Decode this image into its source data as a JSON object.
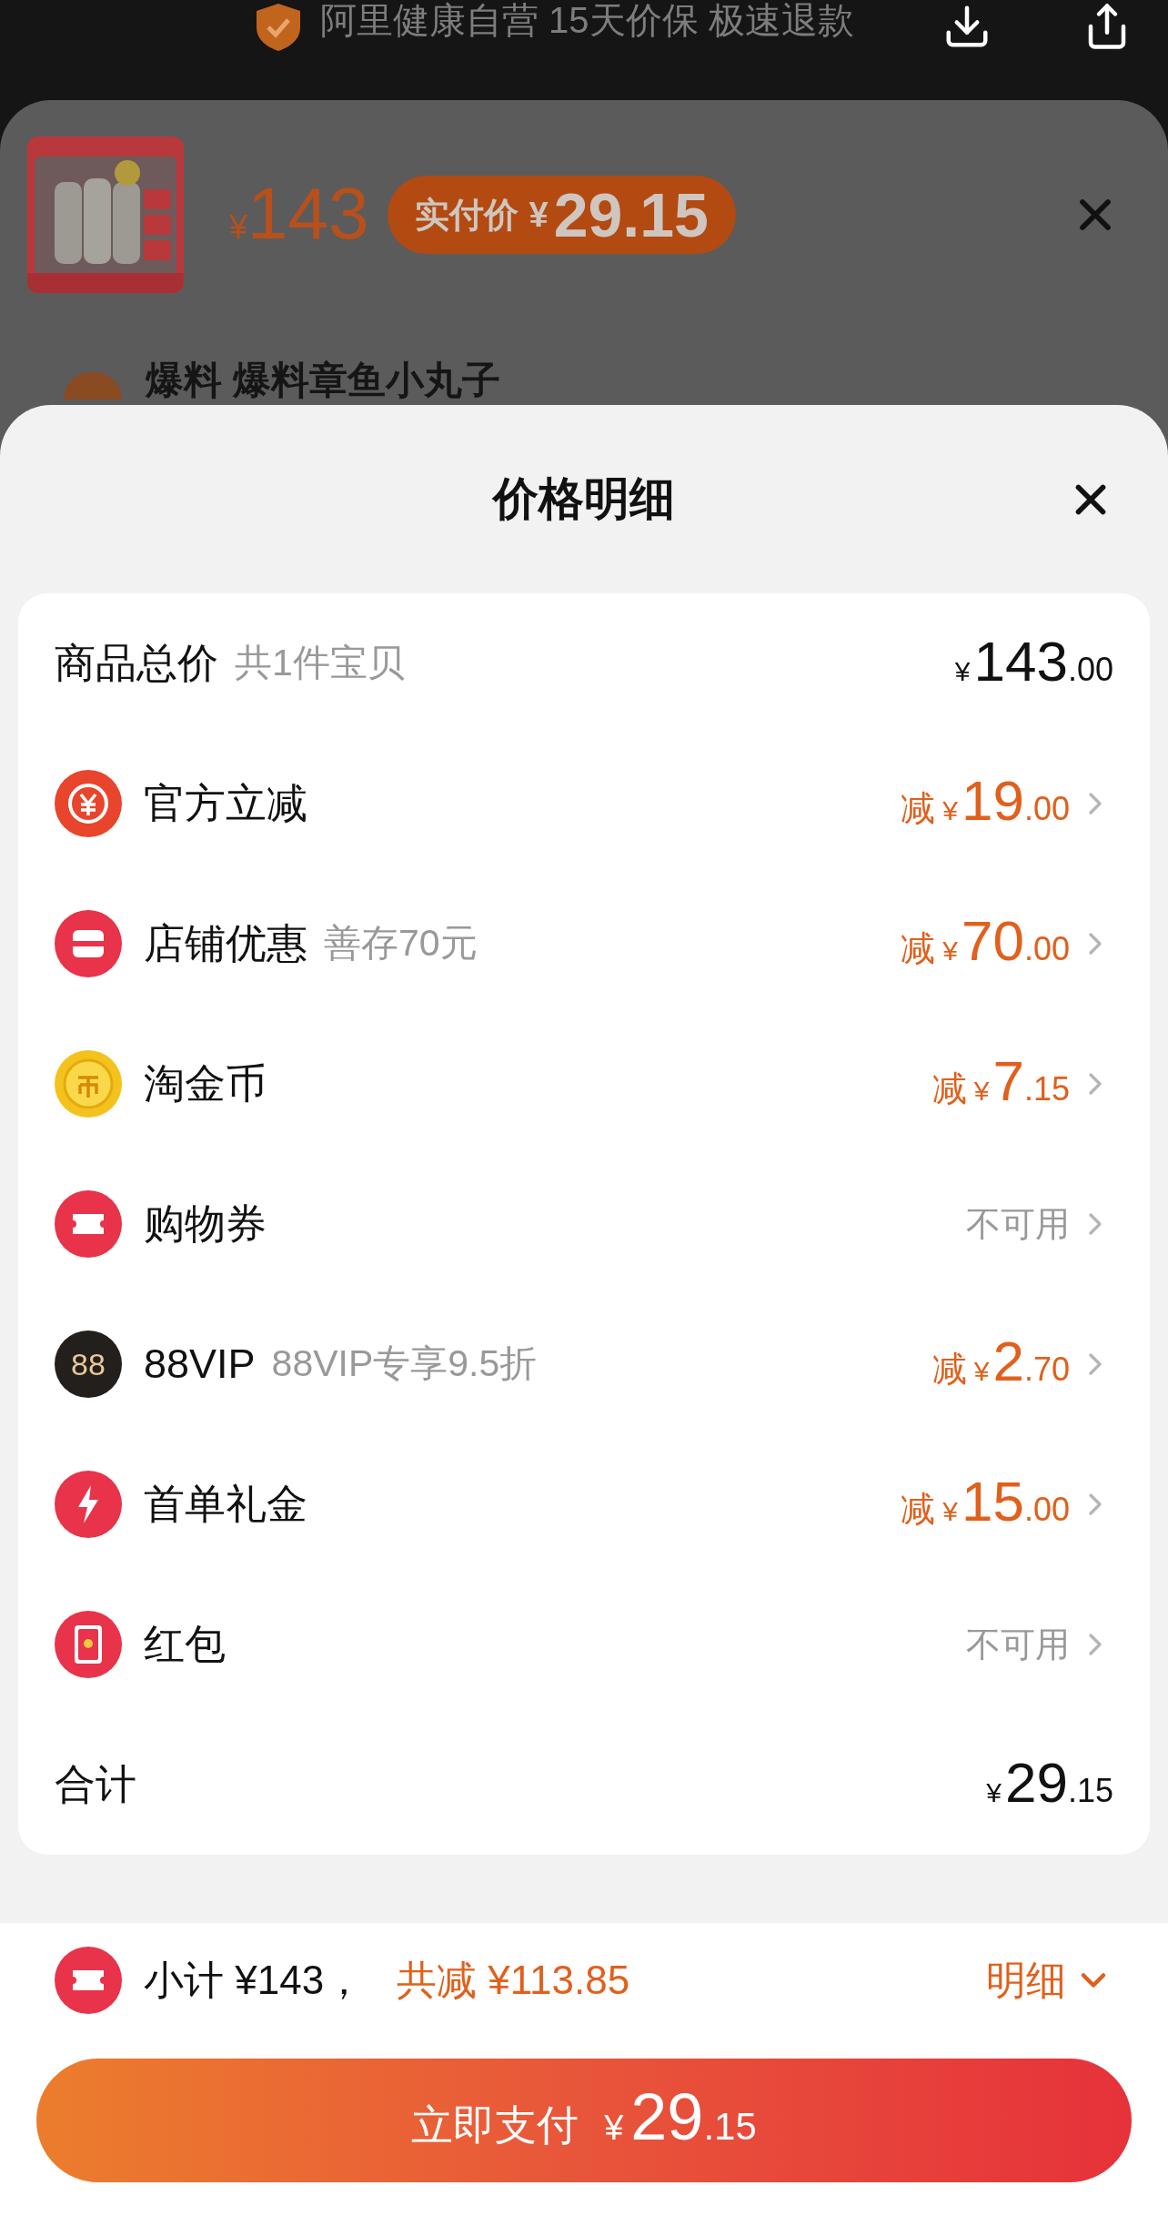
{
  "top_banner": {
    "text": "阿里健康自营 15天价保 极速退款"
  },
  "product_sheet": {
    "price": {
      "currency": "¥",
      "amount": "143"
    },
    "paid_badge": {
      "label": "实付价",
      "currency": "¥",
      "amount": "29.15"
    },
    "item_title": "爆料 爆料章鱼小丸子"
  },
  "price_detail": {
    "title": "价格明细",
    "rows": [
      {
        "kind": "plain",
        "label": "商品总价",
        "note": "共1件宝贝",
        "currency": "¥",
        "amount_int": "143",
        "amount_dec": ".00"
      },
      {
        "kind": "item",
        "label": "官方立减",
        "prefix": "减",
        "currency": "¥",
        "amount_int": "19",
        "amount_dec": ".00"
      },
      {
        "kind": "item",
        "label": "店铺优惠",
        "note": "善存70元",
        "prefix": "减",
        "currency": "¥",
        "amount_int": "70",
        "amount_dec": ".00"
      },
      {
        "kind": "item",
        "label": "淘金币",
        "prefix": "减",
        "currency": "¥",
        "amount_int": "7",
        "amount_dec": ".15"
      },
      {
        "kind": "item",
        "label": "购物券",
        "status": "不可用"
      },
      {
        "kind": "item",
        "icon_text": "88",
        "label": "88VIP",
        "note": "88VIP专享9.5折",
        "prefix": "减",
        "currency": "¥",
        "amount_int": "2",
        "amount_dec": ".70"
      },
      {
        "kind": "item",
        "label": "首单礼金",
        "prefix": "减",
        "currency": "¥",
        "amount_int": "15",
        "amount_dec": ".00"
      },
      {
        "kind": "item",
        "label": "红包",
        "status": "不可用"
      },
      {
        "kind": "plain",
        "label": "合计",
        "currency": "¥",
        "amount_int": "29",
        "amount_dec": ".15"
      }
    ]
  },
  "footer": {
    "subtotal": "小计 ¥143，",
    "discount_total": "共减 ¥113.85",
    "details_link": "明细",
    "pay_button": {
      "label": "立即支付",
      "currency": "¥",
      "amount_int": "29",
      "amount_dec": ".15"
    }
  }
}
